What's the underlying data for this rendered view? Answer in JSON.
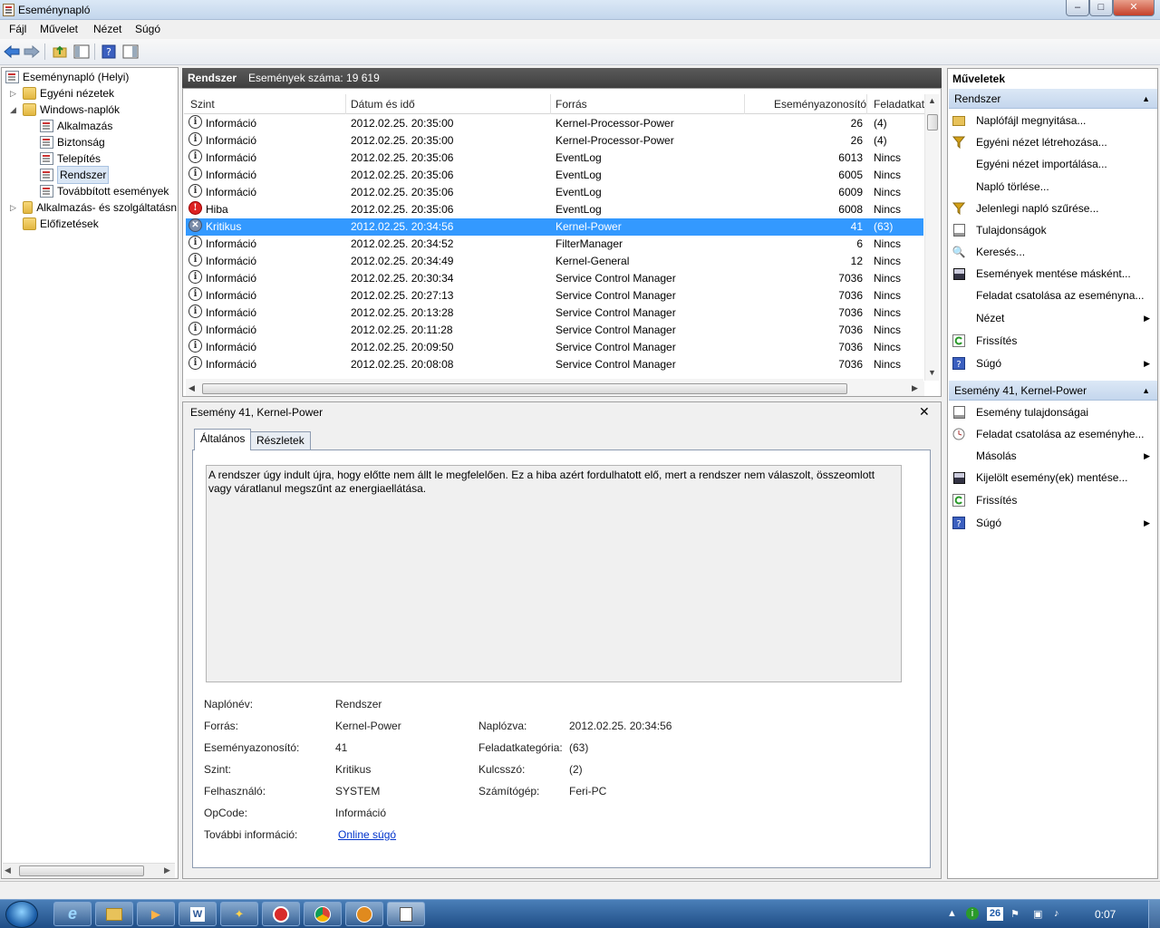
{
  "window": {
    "title": "Eseménynapló",
    "min": "–",
    "max": "□",
    "close": "✕"
  },
  "menu": [
    "Fájl",
    "Művelet",
    "Nézet",
    "Súgó"
  ],
  "tree": {
    "root": "Eseménynapló (Helyi)",
    "custom_views": "Egyéni nézetek",
    "windows_logs": "Windows-naplók",
    "logs": [
      "Alkalmazás",
      "Biztonság",
      "Telepítés",
      "Rendszer",
      "Továbbított események"
    ],
    "app_services": "Alkalmazás- és szolgáltatásn",
    "subscriptions": "Előfizetések"
  },
  "log_header": {
    "name": "Rendszer",
    "count_label": "Események száma: 19 619"
  },
  "columns": [
    "Szint",
    "Dátum és idő",
    "Forrás",
    "Eseményazonosító",
    "Feladatkat"
  ],
  "rows": [
    {
      "level": "Információ",
      "date": "2012.02.25. 20:35:00",
      "source": "Kernel-Processor-Power",
      "id": "26",
      "task": "(4)"
    },
    {
      "level": "Információ",
      "date": "2012.02.25. 20:35:00",
      "source": "Kernel-Processor-Power",
      "id": "26",
      "task": "(4)"
    },
    {
      "level": "Információ",
      "date": "2012.02.25. 20:35:06",
      "source": "EventLog",
      "id": "6013",
      "task": "Nincs"
    },
    {
      "level": "Információ",
      "date": "2012.02.25. 20:35:06",
      "source": "EventLog",
      "id": "6005",
      "task": "Nincs"
    },
    {
      "level": "Információ",
      "date": "2012.02.25. 20:35:06",
      "source": "EventLog",
      "id": "6009",
      "task": "Nincs"
    },
    {
      "level": "Hiba",
      "date": "2012.02.25. 20:35:06",
      "source": "EventLog",
      "id": "6008",
      "task": "Nincs"
    },
    {
      "level": "Kritikus",
      "date": "2012.02.25. 20:34:56",
      "source": "Kernel-Power",
      "id": "41",
      "task": "(63)"
    },
    {
      "level": "Információ",
      "date": "2012.02.25. 20:34:52",
      "source": "FilterManager",
      "id": "6",
      "task": "Nincs"
    },
    {
      "level": "Információ",
      "date": "2012.02.25. 20:34:49",
      "source": "Kernel-General",
      "id": "12",
      "task": "Nincs"
    },
    {
      "level": "Információ",
      "date": "2012.02.25. 20:30:34",
      "source": "Service Control Manager",
      "id": "7036",
      "task": "Nincs"
    },
    {
      "level": "Információ",
      "date": "2012.02.25. 20:27:13",
      "source": "Service Control Manager",
      "id": "7036",
      "task": "Nincs"
    },
    {
      "level": "Információ",
      "date": "2012.02.25. 20:13:28",
      "source": "Service Control Manager",
      "id": "7036",
      "task": "Nincs"
    },
    {
      "level": "Információ",
      "date": "2012.02.25. 20:11:28",
      "source": "Service Control Manager",
      "id": "7036",
      "task": "Nincs"
    },
    {
      "level": "Információ",
      "date": "2012.02.25. 20:09:50",
      "source": "Service Control Manager",
      "id": "7036",
      "task": "Nincs"
    },
    {
      "level": "Információ",
      "date": "2012.02.25. 20:08:08",
      "source": "Service Control Manager",
      "id": "7036",
      "task": "Nincs"
    }
  ],
  "detail": {
    "title": "Esemény 41, Kernel-Power",
    "tabs": [
      "Általános",
      "Részletek"
    ],
    "description": "A rendszer úgy indult újra, hogy előtte nem állt le megfelelően. Ez a hiba azért fordulhatott elő, mert a rendszer nem válaszolt, összeomlott vagy váratlanul megszűnt az energiaellátása.",
    "fields": {
      "log_name_label": "Naplónév:",
      "log_name": "Rendszer",
      "source_label": "Forrás:",
      "source": "Kernel-Power",
      "logged_label": "Naplózva:",
      "logged": "2012.02.25. 20:34:56",
      "event_id_label": "Eseményazonosító:",
      "event_id": "41",
      "task_label": "Feladatkategória:",
      "task": "(63)",
      "level_label": "Szint:",
      "level": "Kritikus",
      "keywords_label": "Kulcsszó:",
      "keywords": "(2)",
      "user_label": "Felhasználó:",
      "user": "SYSTEM",
      "computer_label": "Számítógép:",
      "computer": "Feri-PC",
      "opcode_label": "OpCode:",
      "opcode": "Információ",
      "more_info_label": "További információ:",
      "more_info": "Online súgó"
    }
  },
  "actions": {
    "title": "Műveletek",
    "section1": "Rendszer",
    "items1": [
      "Naplófájl megnyitása...",
      "Egyéni nézet létrehozása...",
      "Egyéni nézet importálása...",
      "Napló törlése...",
      "Jelenlegi napló szűrése...",
      "Tulajdonságok",
      "Keresés...",
      "Események mentése másként...",
      "Feladat csatolása az eseménynа...",
      "Nézet",
      "Frissítés",
      "Súgó"
    ],
    "section2": "Esemény 41, Kernel-Power",
    "items2": [
      "Esemény tulajdonságai",
      "Feladat csatolása az eseményhe...",
      "Másolás",
      "Kijelölt esemény(ek) mentése...",
      "Frissítés",
      "Súgó"
    ]
  },
  "taskbar": {
    "clock": "0:07",
    "tray_date": "26"
  },
  "colors": {
    "selection": "#3399ff",
    "header_dark": "#4a4a4a",
    "link": "#0033cc"
  }
}
